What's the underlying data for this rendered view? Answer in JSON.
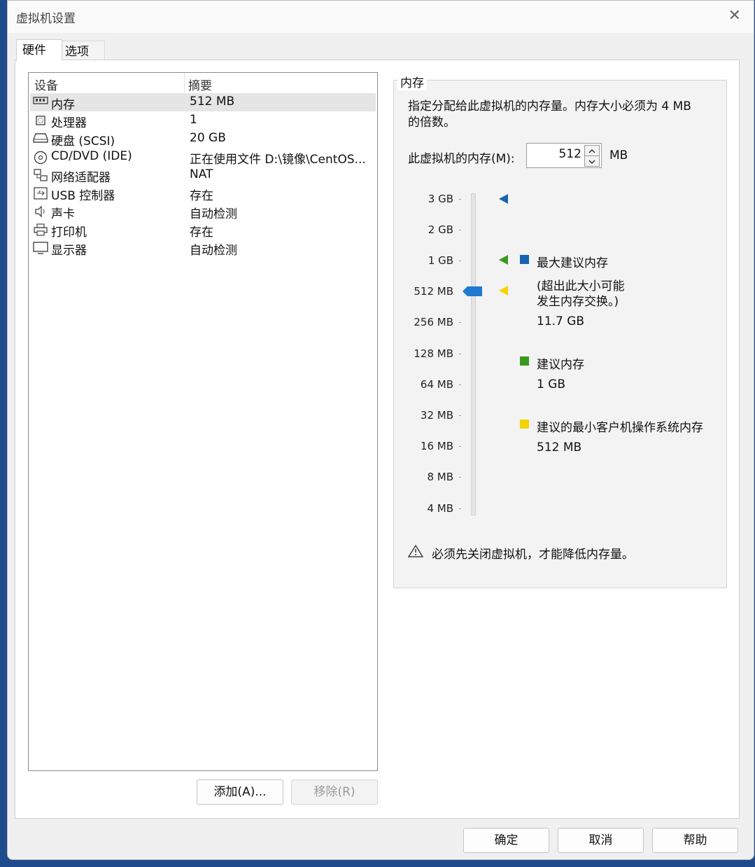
{
  "window": {
    "title": "虚拟机设置",
    "close_glyph": "✕"
  },
  "tabs": [
    {
      "label": "硬件",
      "active": true
    },
    {
      "label": "选项",
      "active": false
    }
  ],
  "device_list": {
    "columns": [
      "设备",
      "摘要"
    ],
    "rows": [
      {
        "icon": "memory-icon",
        "name": "内存",
        "summary": "512 MB",
        "selected": true
      },
      {
        "icon": "processor-icon",
        "name": "处理器",
        "summary": "1"
      },
      {
        "icon": "harddisk-icon",
        "name": "硬盘 (SCSI)",
        "summary": "20 GB"
      },
      {
        "icon": "cd-dvd-icon",
        "name": "CD/DVD (IDE)",
        "summary": "正在使用文件 D:\\镜像\\CentOS..."
      },
      {
        "icon": "network-icon",
        "name": "网络适配器",
        "summary": "NAT"
      },
      {
        "icon": "usb-icon",
        "name": "USB 控制器",
        "summary": "存在"
      },
      {
        "icon": "sound-icon",
        "name": "声卡",
        "summary": "自动检测"
      },
      {
        "icon": "printer-icon",
        "name": "打印机",
        "summary": "存在"
      },
      {
        "icon": "display-icon",
        "name": "显示器",
        "summary": "自动检测"
      }
    ],
    "add_button": "添加(A)...",
    "remove_button": "移除(R)"
  },
  "memory": {
    "group_title": "内存",
    "description_line1": "指定分配给此虚拟机的内存量。内存大小必须为 4 MB",
    "description_line2": "的倍数。",
    "input_label": "此虚拟机的内存(M):",
    "value": "512",
    "unit": "MB",
    "scale_labels": [
      "3 GB",
      "2 GB",
      "1 GB",
      "512 MB",
      "256 MB",
      "128 MB",
      "64 MB",
      "32 MB",
      "16 MB",
      "8 MB",
      "4 MB"
    ],
    "slider_value_label": "512 MB",
    "legend": {
      "max": {
        "title": "最大建议内存",
        "note_line1": "(超出此大小可能",
        "note_line2": "发生内存交换。)",
        "value": "11.7 GB",
        "color": "#1565b0"
      },
      "recommended": {
        "title": "建议内存",
        "value": "1 GB",
        "color": "#3a9a1e"
      },
      "min_guest": {
        "title": "建议的最小客户机操作系统内存",
        "value": "512 MB",
        "color": "#f4d400"
      }
    },
    "marker_top_color": "#1565b0",
    "warning": "必须先关闭虚拟机，才能降低内存量。"
  },
  "footer": {
    "ok": "确定",
    "cancel": "取消",
    "help": "帮助"
  }
}
